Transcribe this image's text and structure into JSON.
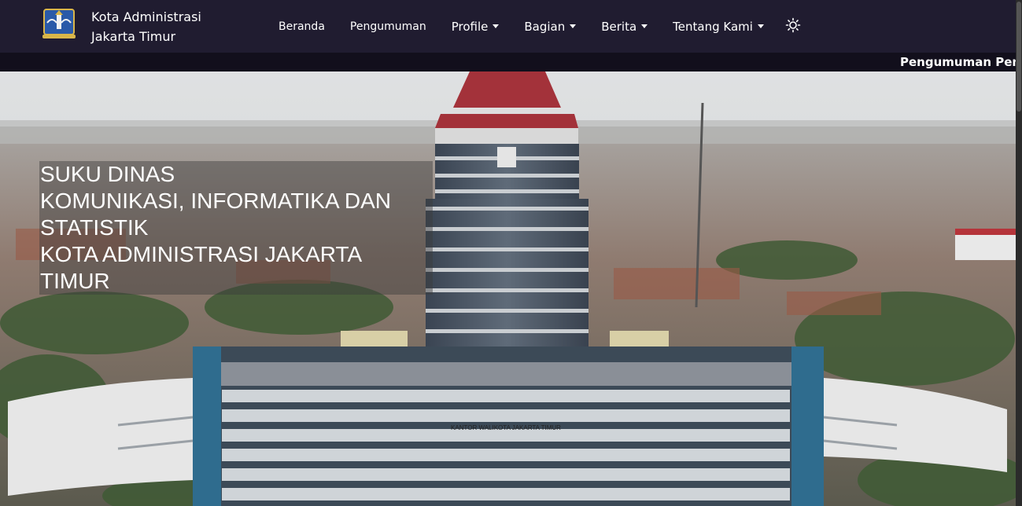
{
  "brand": {
    "line1": "Kota Administrasi",
    "line2": "Jakarta Timur",
    "logo_icon": "city-emblem-icon"
  },
  "nav": {
    "beranda": "Beranda",
    "pengumuman": "Pengumuman",
    "profile": "Profile",
    "bagian": "Bagian",
    "berita": "Berita",
    "tentang_kami": "Tentang Kami",
    "theme_icon": "sun-icon"
  },
  "ticker": {
    "text": "Pengumuman Pene"
  },
  "hero": {
    "line1": "SUKU DINAS",
    "line2": "KOMUNIKASI, INFORMATIKA DAN",
    "line3": "STATISTIK",
    "line4": "KOTA ADMINISTRASI JAKARTA",
    "line5": "TIMUR",
    "building_sign": "KANTOR WALIKOTA JAKARTA TIMUR"
  },
  "colors": {
    "navbar": "#201c30",
    "ticker": "#120f1c",
    "roof": "#a3323a"
  }
}
